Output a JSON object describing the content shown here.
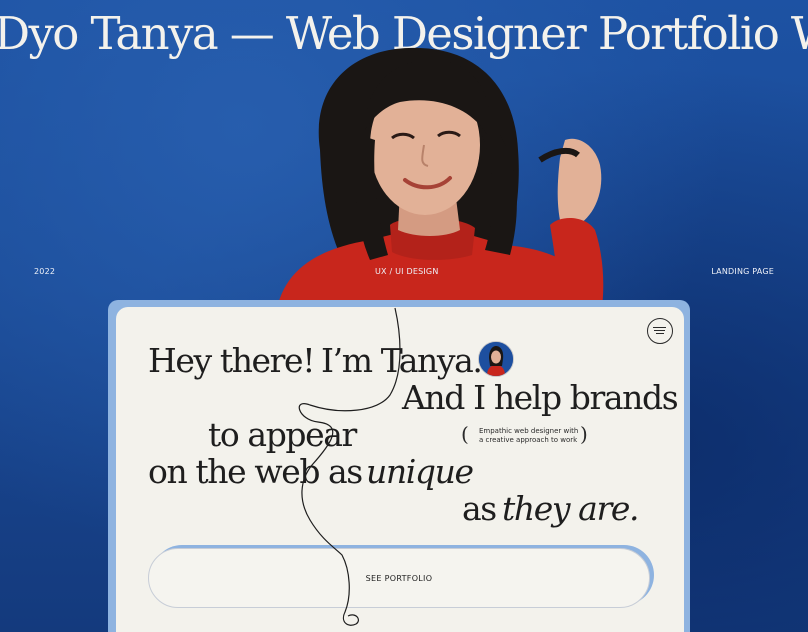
{
  "headline": "Dyo Tanya — Web Designer Portfolio Website",
  "meta": {
    "year": "2022",
    "category": "UX / UI DESIGN",
    "type": "LANDING PAGE"
  },
  "hero": {
    "line1_a": "Hey there!",
    "line1_b": "I’m Tanya.",
    "line2": "And I help brands",
    "line3": "to appear",
    "line4_a": "on the web",
    "line4_b": "as",
    "line4_c": "unique",
    "line5_a": "as",
    "line5_b": "they are."
  },
  "tagline": {
    "line1": "Empathic web designer with",
    "line2": "a creative approach to work",
    "open_paren": "(",
    "close_paren": ")"
  },
  "cta_label": "SEE PORTFOLIO",
  "icons": {
    "menu": "menu-icon",
    "avatar": "avatar"
  },
  "colors": {
    "background_blue": "#1c4c9a",
    "card": "#f3f2ec",
    "card_frame": "#8eb3e0",
    "sweater_red": "#c8261c",
    "text": "#1e1e1e"
  }
}
